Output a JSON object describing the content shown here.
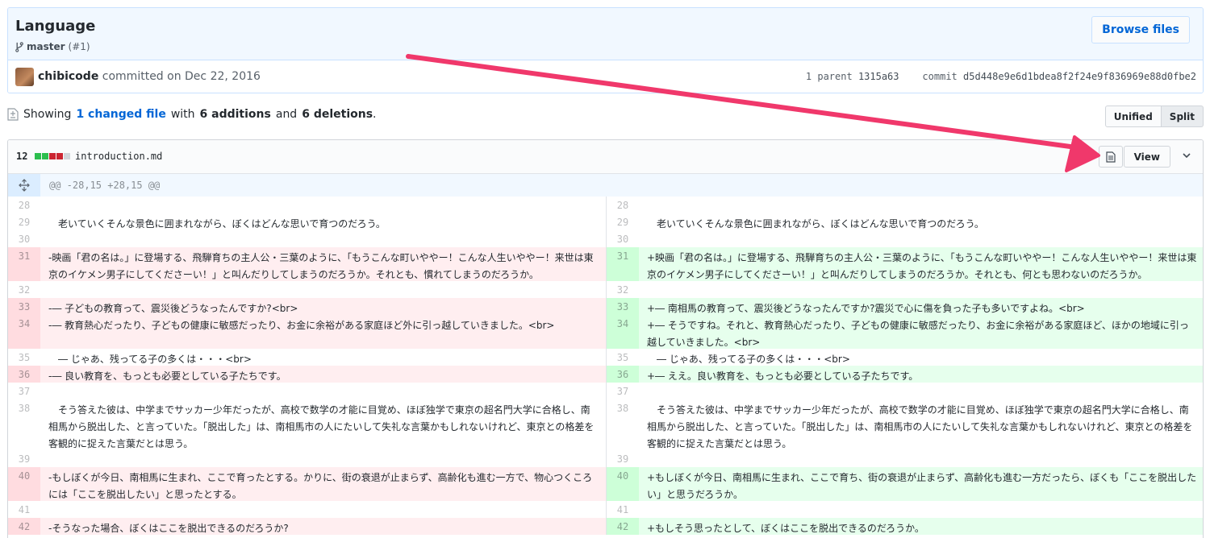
{
  "commit": {
    "title": "Language",
    "branch": "master",
    "pr": "(#1)",
    "browse_label": "Browse files",
    "author": "chibicode",
    "committed_text": "committed on Dec 22, 2016",
    "parent_label": "1 parent",
    "parent_sha": "1315a63",
    "commit_label": "commit",
    "commit_sha": "d5d448e9e6d1bdea8f2f24e9f836969e88d0fbe2"
  },
  "toc": {
    "showing": "Showing",
    "changed": "1 changed file",
    "with": "with",
    "additions": "6 additions",
    "and": "and",
    "deletions": "6 deletions",
    "dot": ".",
    "unified": "Unified",
    "split": "Split"
  },
  "file": {
    "count": "12",
    "name": "introduction.md",
    "view_label": "View",
    "hunk": "@@ -28,15 +28,15 @@"
  },
  "diff_rows": [
    {
      "type": "ctx",
      "h": 21,
      "ln": "28",
      "rn": "28",
      "l": "",
      "r": ""
    },
    {
      "type": "ctx",
      "h": 21,
      "ln": "29",
      "rn": "29",
      "l": "　老いていくそんな景色に囲まれながら、ぼくはどんな思いで育つのだろう。",
      "r": "　老いていくそんな景色に囲まれながら、ぼくはどんな思いで育つのだろう。"
    },
    {
      "type": "ctx",
      "h": 21,
      "ln": "30",
      "rn": "30",
      "l": "",
      "r": ""
    },
    {
      "type": "chg",
      "h": 42,
      "ln": "31",
      "rn": "31",
      "l": "-映画「君の名は。」に登場する、飛騨育ちの主人公・三葉のように、「もうこんな町いややー！こんな人生いややー！来世は東京のイケメン男子にしてくださーい！」と叫んだりしてしまうのだろうか。それとも、慣れてしまうのだろうか。",
      "r": "+映画「君の名は。」に登場する、飛騨育ちの主人公・三葉のように、「もうこんな町いややー！こんな人生いややー！来世は東京のイケメン男子にしてくださーい！」と叫んだりしてしまうのだろうか。それとも、何とも思わないのだろうか。"
    },
    {
      "type": "ctx",
      "h": 21,
      "ln": "32",
      "rn": "32",
      "l": "",
      "r": ""
    },
    {
      "type": "chg",
      "h": 21,
      "ln": "33",
      "rn": "33",
      "l": "-― 子どもの教育って、震災後どうなったんですか?<br>",
      "r": "+― 南相馬の教育って、震災後どうなったんですか?震災で心に傷を負った子も多いですよね。<br>"
    },
    {
      "type": "chg",
      "h": 42,
      "ln": "34",
      "rn": "34",
      "l": "-― 教育熱心だったり、子どもの健康に敏感だったり、お金に余裕がある家庭ほど外に引っ越していきました。<br>",
      "r": "+― そうですね。それと、教育熱心だったり、子どもの健康に敏感だったり、お金に余裕がある家庭ほど、ほかの地域に引っ越していきました。<br>"
    },
    {
      "type": "ctx",
      "h": 21,
      "ln": "35",
      "rn": "35",
      "l": "　― じゃあ、残ってる子の多くは・・・<br>",
      "r": "　― じゃあ、残ってる子の多くは・・・<br>"
    },
    {
      "type": "chg",
      "h": 21,
      "ln": "36",
      "rn": "36",
      "l": "-― 良い教育を、もっとも必要としている子たちです。",
      "r": "+― ええ。良い教育を、もっとも必要としている子たちです。"
    },
    {
      "type": "ctx",
      "h": 21,
      "ln": "37",
      "rn": "37",
      "l": "",
      "r": ""
    },
    {
      "type": "ctx",
      "h": 63,
      "ln": "38",
      "rn": "38",
      "l": "　そう答えた彼は、中学までサッカー少年だったが、高校で数学の才能に目覚め、ほぼ独学で東京の超名門大学に合格し、南相馬から脱出した、と言っていた。「脱出した」は、南相馬市の人にたいして失礼な言葉かもしれないけれど、東京との格差を客観的に捉えた言葉だとは思う。",
      "r": "　そう答えた彼は、中学までサッカー少年だったが、高校で数学の才能に目覚め、ほぼ独学で東京の超名門大学に合格し、南相馬から脱出した、と言っていた。「脱出した」は、南相馬市の人にたいして失礼な言葉かもしれないけれど、東京との格差を客観的に捉えた言葉だとは思う。"
    },
    {
      "type": "ctx",
      "h": 21,
      "ln": "39",
      "rn": "39",
      "l": "",
      "r": ""
    },
    {
      "type": "chg",
      "h": 42,
      "ln": "40",
      "rn": "40",
      "l": "-もしぼくが今日、南相馬に生まれ、ここで育ったとする。かりに、街の衰退が止まらず、高齢化も進む一方で、物心つくころには「ここを脱出したい」と思ったとする。",
      "r": "+もしぼくが今日、南相馬に生まれ、ここで育ち、街の衰退が止まらず、高齢化も進む一方だったら、ぼくも「ここを脱出したい」と思うだろうか。"
    },
    {
      "type": "ctx",
      "h": 21,
      "ln": "41",
      "rn": "41",
      "l": "",
      "r": ""
    },
    {
      "type": "chg",
      "h": 21,
      "ln": "42",
      "rn": "42",
      "l": "-そうなった場合、ぼくはここを脱出できるのだろうか?",
      "r": "+もしそう思ったとして、ぼくはここを脱出できるのだろうか。"
    }
  ],
  "colors": {
    "link": "#0366d6",
    "add_bg": "#e6ffed",
    "del_bg": "#ffeef0",
    "arrow": "#f0386b",
    "diffstat_add": "#2cbe4e",
    "diffstat_del": "#cb2431"
  }
}
